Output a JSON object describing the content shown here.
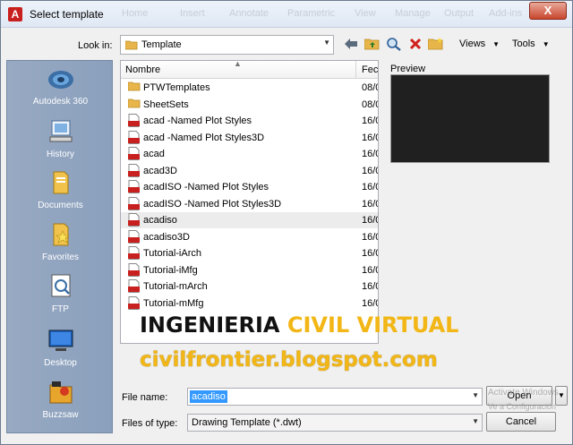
{
  "window": {
    "title": "Select template",
    "close_label": "X",
    "bg_ghost_items": [
      "Home",
      "Insert",
      "Annotate",
      "Parametric",
      "View",
      "Manage",
      "Output",
      "Add-ins"
    ]
  },
  "lookin": {
    "label": "Look in:",
    "value": "Template"
  },
  "toolbar": {
    "views_label": "Views",
    "tools_label": "Tools"
  },
  "places": [
    {
      "label": "Autodesk 360"
    },
    {
      "label": "History"
    },
    {
      "label": "Documents"
    },
    {
      "label": "Favorites"
    },
    {
      "label": "FTP"
    },
    {
      "label": "Desktop"
    },
    {
      "label": "Buzzsaw"
    }
  ],
  "filelist": {
    "col_name": "Nombre",
    "col_date": "Fecl",
    "rows": [
      {
        "name": "PTWTemplates",
        "date": "08/0",
        "type": "folder"
      },
      {
        "name": "SheetSets",
        "date": "08/0",
        "type": "folder"
      },
      {
        "name": "acad -Named Plot Styles",
        "date": "16/0",
        "type": "dwt"
      },
      {
        "name": "acad -Named Plot Styles3D",
        "date": "16/0",
        "type": "dwt"
      },
      {
        "name": "acad",
        "date": "16/0",
        "type": "dwt"
      },
      {
        "name": "acad3D",
        "date": "16/0",
        "type": "dwt"
      },
      {
        "name": "acadISO -Named Plot Styles",
        "date": "16/0",
        "type": "dwt"
      },
      {
        "name": "acadISO -Named Plot Styles3D",
        "date": "16/0",
        "type": "dwt"
      },
      {
        "name": "acadiso",
        "date": "16/0",
        "type": "dwt",
        "selected": true
      },
      {
        "name": "acadiso3D",
        "date": "16/0",
        "type": "dwt"
      },
      {
        "name": "Tutorial-iArch",
        "date": "16/0",
        "type": "dwt"
      },
      {
        "name": "Tutorial-iMfg",
        "date": "16/0",
        "type": "dwt"
      },
      {
        "name": "Tutorial-mArch",
        "date": "16/0",
        "type": "dwt"
      },
      {
        "name": "Tutorial-mMfg",
        "date": "16/0",
        "type": "dwt"
      }
    ]
  },
  "preview": {
    "label": "Preview"
  },
  "watermark": {
    "line1_a": "INGENIERIA ",
    "line1_b": "CIVIL VIRTUAL",
    "line2": "civilfrontier.blogspot.com"
  },
  "file_name": {
    "label": "File name:",
    "value": "acadiso"
  },
  "file_type": {
    "label": "Files of type:",
    "value": "Drawing Template (*.dwt)"
  },
  "buttons": {
    "open": "Open",
    "cancel": "Cancel"
  },
  "activation": {
    "line1": "Activate Windows",
    "line2": "Ve a Configuración"
  },
  "colors": {
    "accent_yellow": "#f2b716",
    "places_bg": "#8aa0bd",
    "close_red": "#c9462c",
    "selection_blue": "#3399ff"
  }
}
